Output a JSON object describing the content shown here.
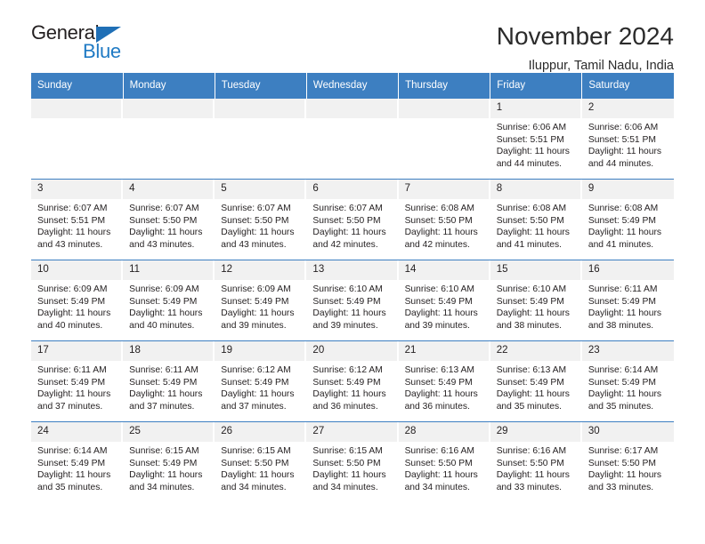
{
  "brand": {
    "name_part1": "General",
    "name_part2": "Blue",
    "triangle_color": "#1f6fb6",
    "blue_color": "#1f7ac4"
  },
  "header": {
    "title": "November 2024",
    "subtitle": "Iluppur, Tamil Nadu, India"
  },
  "theme": {
    "header_blue": "#3d7fc1",
    "daynum_gray": "#f1f1f1",
    "text": "#231f20"
  },
  "weekdays": [
    "Sunday",
    "Monday",
    "Tuesday",
    "Wednesday",
    "Thursday",
    "Friday",
    "Saturday"
  ],
  "weeks": [
    [
      {
        "day": "",
        "sunrise": "",
        "sunset": "",
        "daylight1": "",
        "daylight2": ""
      },
      {
        "day": "",
        "sunrise": "",
        "sunset": "",
        "daylight1": "",
        "daylight2": ""
      },
      {
        "day": "",
        "sunrise": "",
        "sunset": "",
        "daylight1": "",
        "daylight2": ""
      },
      {
        "day": "",
        "sunrise": "",
        "sunset": "",
        "daylight1": "",
        "daylight2": ""
      },
      {
        "day": "",
        "sunrise": "",
        "sunset": "",
        "daylight1": "",
        "daylight2": ""
      },
      {
        "day": "1",
        "sunrise": "Sunrise: 6:06 AM",
        "sunset": "Sunset: 5:51 PM",
        "daylight1": "Daylight: 11 hours",
        "daylight2": "and 44 minutes."
      },
      {
        "day": "2",
        "sunrise": "Sunrise: 6:06 AM",
        "sunset": "Sunset: 5:51 PM",
        "daylight1": "Daylight: 11 hours",
        "daylight2": "and 44 minutes."
      }
    ],
    [
      {
        "day": "3",
        "sunrise": "Sunrise: 6:07 AM",
        "sunset": "Sunset: 5:51 PM",
        "daylight1": "Daylight: 11 hours",
        "daylight2": "and 43 minutes."
      },
      {
        "day": "4",
        "sunrise": "Sunrise: 6:07 AM",
        "sunset": "Sunset: 5:50 PM",
        "daylight1": "Daylight: 11 hours",
        "daylight2": "and 43 minutes."
      },
      {
        "day": "5",
        "sunrise": "Sunrise: 6:07 AM",
        "sunset": "Sunset: 5:50 PM",
        "daylight1": "Daylight: 11 hours",
        "daylight2": "and 43 minutes."
      },
      {
        "day": "6",
        "sunrise": "Sunrise: 6:07 AM",
        "sunset": "Sunset: 5:50 PM",
        "daylight1": "Daylight: 11 hours",
        "daylight2": "and 42 minutes."
      },
      {
        "day": "7",
        "sunrise": "Sunrise: 6:08 AM",
        "sunset": "Sunset: 5:50 PM",
        "daylight1": "Daylight: 11 hours",
        "daylight2": "and 42 minutes."
      },
      {
        "day": "8",
        "sunrise": "Sunrise: 6:08 AM",
        "sunset": "Sunset: 5:50 PM",
        "daylight1": "Daylight: 11 hours",
        "daylight2": "and 41 minutes."
      },
      {
        "day": "9",
        "sunrise": "Sunrise: 6:08 AM",
        "sunset": "Sunset: 5:49 PM",
        "daylight1": "Daylight: 11 hours",
        "daylight2": "and 41 minutes."
      }
    ],
    [
      {
        "day": "10",
        "sunrise": "Sunrise: 6:09 AM",
        "sunset": "Sunset: 5:49 PM",
        "daylight1": "Daylight: 11 hours",
        "daylight2": "and 40 minutes."
      },
      {
        "day": "11",
        "sunrise": "Sunrise: 6:09 AM",
        "sunset": "Sunset: 5:49 PM",
        "daylight1": "Daylight: 11 hours",
        "daylight2": "and 40 minutes."
      },
      {
        "day": "12",
        "sunrise": "Sunrise: 6:09 AM",
        "sunset": "Sunset: 5:49 PM",
        "daylight1": "Daylight: 11 hours",
        "daylight2": "and 39 minutes."
      },
      {
        "day": "13",
        "sunrise": "Sunrise: 6:10 AM",
        "sunset": "Sunset: 5:49 PM",
        "daylight1": "Daylight: 11 hours",
        "daylight2": "and 39 minutes."
      },
      {
        "day": "14",
        "sunrise": "Sunrise: 6:10 AM",
        "sunset": "Sunset: 5:49 PM",
        "daylight1": "Daylight: 11 hours",
        "daylight2": "and 39 minutes."
      },
      {
        "day": "15",
        "sunrise": "Sunrise: 6:10 AM",
        "sunset": "Sunset: 5:49 PM",
        "daylight1": "Daylight: 11 hours",
        "daylight2": "and 38 minutes."
      },
      {
        "day": "16",
        "sunrise": "Sunrise: 6:11 AM",
        "sunset": "Sunset: 5:49 PM",
        "daylight1": "Daylight: 11 hours",
        "daylight2": "and 38 minutes."
      }
    ],
    [
      {
        "day": "17",
        "sunrise": "Sunrise: 6:11 AM",
        "sunset": "Sunset: 5:49 PM",
        "daylight1": "Daylight: 11 hours",
        "daylight2": "and 37 minutes."
      },
      {
        "day": "18",
        "sunrise": "Sunrise: 6:11 AM",
        "sunset": "Sunset: 5:49 PM",
        "daylight1": "Daylight: 11 hours",
        "daylight2": "and 37 minutes."
      },
      {
        "day": "19",
        "sunrise": "Sunrise: 6:12 AM",
        "sunset": "Sunset: 5:49 PM",
        "daylight1": "Daylight: 11 hours",
        "daylight2": "and 37 minutes."
      },
      {
        "day": "20",
        "sunrise": "Sunrise: 6:12 AM",
        "sunset": "Sunset: 5:49 PM",
        "daylight1": "Daylight: 11 hours",
        "daylight2": "and 36 minutes."
      },
      {
        "day": "21",
        "sunrise": "Sunrise: 6:13 AM",
        "sunset": "Sunset: 5:49 PM",
        "daylight1": "Daylight: 11 hours",
        "daylight2": "and 36 minutes."
      },
      {
        "day": "22",
        "sunrise": "Sunrise: 6:13 AM",
        "sunset": "Sunset: 5:49 PM",
        "daylight1": "Daylight: 11 hours",
        "daylight2": "and 35 minutes."
      },
      {
        "day": "23",
        "sunrise": "Sunrise: 6:14 AM",
        "sunset": "Sunset: 5:49 PM",
        "daylight1": "Daylight: 11 hours",
        "daylight2": "and 35 minutes."
      }
    ],
    [
      {
        "day": "24",
        "sunrise": "Sunrise: 6:14 AM",
        "sunset": "Sunset: 5:49 PM",
        "daylight1": "Daylight: 11 hours",
        "daylight2": "and 35 minutes."
      },
      {
        "day": "25",
        "sunrise": "Sunrise: 6:15 AM",
        "sunset": "Sunset: 5:49 PM",
        "daylight1": "Daylight: 11 hours",
        "daylight2": "and 34 minutes."
      },
      {
        "day": "26",
        "sunrise": "Sunrise: 6:15 AM",
        "sunset": "Sunset: 5:50 PM",
        "daylight1": "Daylight: 11 hours",
        "daylight2": "and 34 minutes."
      },
      {
        "day": "27",
        "sunrise": "Sunrise: 6:15 AM",
        "sunset": "Sunset: 5:50 PM",
        "daylight1": "Daylight: 11 hours",
        "daylight2": "and 34 minutes."
      },
      {
        "day": "28",
        "sunrise": "Sunrise: 6:16 AM",
        "sunset": "Sunset: 5:50 PM",
        "daylight1": "Daylight: 11 hours",
        "daylight2": "and 34 minutes."
      },
      {
        "day": "29",
        "sunrise": "Sunrise: 6:16 AM",
        "sunset": "Sunset: 5:50 PM",
        "daylight1": "Daylight: 11 hours",
        "daylight2": "and 33 minutes."
      },
      {
        "day": "30",
        "sunrise": "Sunrise: 6:17 AM",
        "sunset": "Sunset: 5:50 PM",
        "daylight1": "Daylight: 11 hours",
        "daylight2": "and 33 minutes."
      }
    ]
  ]
}
